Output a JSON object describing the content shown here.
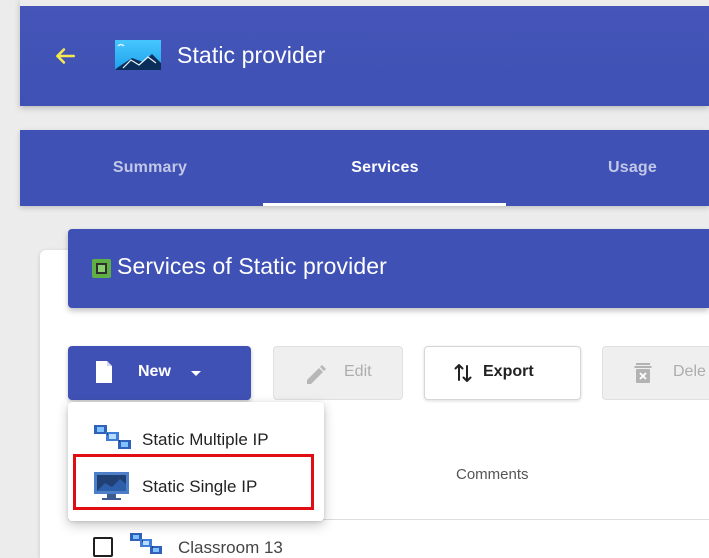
{
  "header": {
    "title": "Static provider",
    "back_icon": "arrow-left-icon",
    "provider_icon": "image-landscape-icon"
  },
  "tabs": {
    "items": [
      {
        "label": "Summary",
        "active": false
      },
      {
        "label": "Services",
        "active": true
      },
      {
        "label": "Usage",
        "active": false
      }
    ]
  },
  "panel": {
    "title": "Services of Static provider",
    "icon": "services-chip-icon"
  },
  "toolbar": {
    "new_label": "New",
    "edit_label": "Edit",
    "export_label": "Export",
    "delete_label": "Dele"
  },
  "menu": {
    "items": [
      {
        "label": "Static Multiple IP",
        "icon": "network-multi-icon"
      },
      {
        "label": "Static Single IP",
        "icon": "monitor-icon"
      }
    ]
  },
  "table": {
    "headers": {
      "comments": "Comments"
    },
    "rows": [
      {
        "name": "Classroom 13"
      }
    ]
  },
  "colors": {
    "primary": "#3f51b5",
    "highlight": "#e00d12",
    "back_arrow": "#f6e94d"
  }
}
